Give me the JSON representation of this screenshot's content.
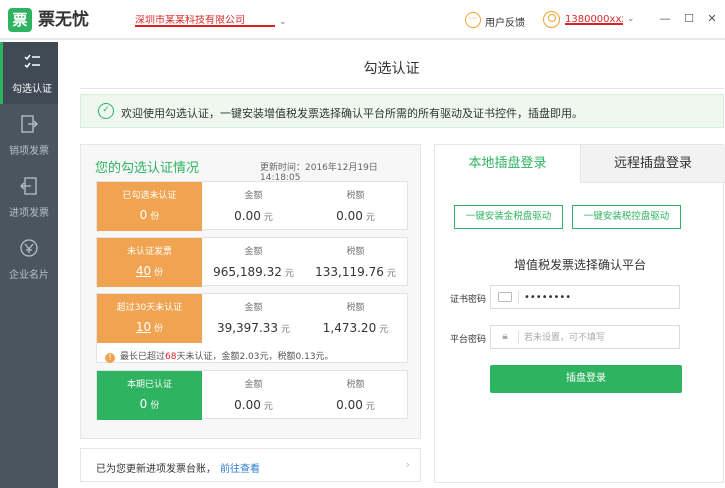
{
  "app": {
    "logo_char": "票",
    "name": "票无忧"
  },
  "header": {
    "company_name": "深圳市某某科技有限公司",
    "feedback_label": "用户反馈",
    "user_name": "1380000xxxx"
  },
  "sidebar": {
    "items": [
      {
        "label": "勾选认证",
        "icon": "checklist-icon",
        "active": true
      },
      {
        "label": "销项发票",
        "icon": "invoice-out-icon",
        "active": false
      },
      {
        "label": "进项发票",
        "icon": "invoice-in-icon",
        "active": false
      },
      {
        "label": "企业名片",
        "icon": "business-card-icon",
        "active": false
      }
    ]
  },
  "main": {
    "title": "勾选认证",
    "welcome": "欢迎使用勾选认证，一键安装增值税发票选择确认平台所需的所有驱动及证书控件，插盘即用。"
  },
  "summary": {
    "title": "您的勾选认证情况",
    "updated": "更新时间：2016年12月19日  14:18:05",
    "amount_label": "金额",
    "tax_label": "税额",
    "unit_yuan": "元",
    "unit_fen": "份",
    "cards": [
      {
        "label": "已勾选未认证",
        "count": "0",
        "amount": "0.00",
        "tax": "0.00",
        "color": "orange"
      },
      {
        "label": "未认证发票",
        "count": "40",
        "amount": "965,189.32",
        "tax": "133,119.76",
        "color": "orange"
      },
      {
        "label": "超过30天未认证",
        "count": "10",
        "amount": "39,397.33",
        "tax": "1,473.20",
        "color": "orange"
      },
      {
        "label": "本期已认证",
        "count": "0",
        "amount": "0.00",
        "tax": "0.00",
        "color": "green"
      }
    ],
    "note": {
      "prefix": "最长已超过",
      "days": "68",
      "suffix": "天未认证，金额2.03元，税额0.13元。"
    }
  },
  "footer": {
    "text": "已为您更新进项发票台账，",
    "link": "前往查看"
  },
  "login_panel": {
    "tab_local": "本地插盘登录",
    "tab_remote": "远程插盘登录",
    "btn_install_gold": "一键安装金税盘驱动",
    "btn_install_control": "一键安装税控盘驱动",
    "platform_title": "增值税发票选择确认平台",
    "cert_label": "证书密码",
    "cert_value": "••••••••",
    "platform_label": "平台密码",
    "platform_placeholder": "若未设置，可不填写",
    "login_button": "插盘登录"
  },
  "colors": {
    "accent": "#2eb360",
    "orange": "#f0a451",
    "link": "#2e7bd6",
    "sidebar": "#4a5560"
  }
}
